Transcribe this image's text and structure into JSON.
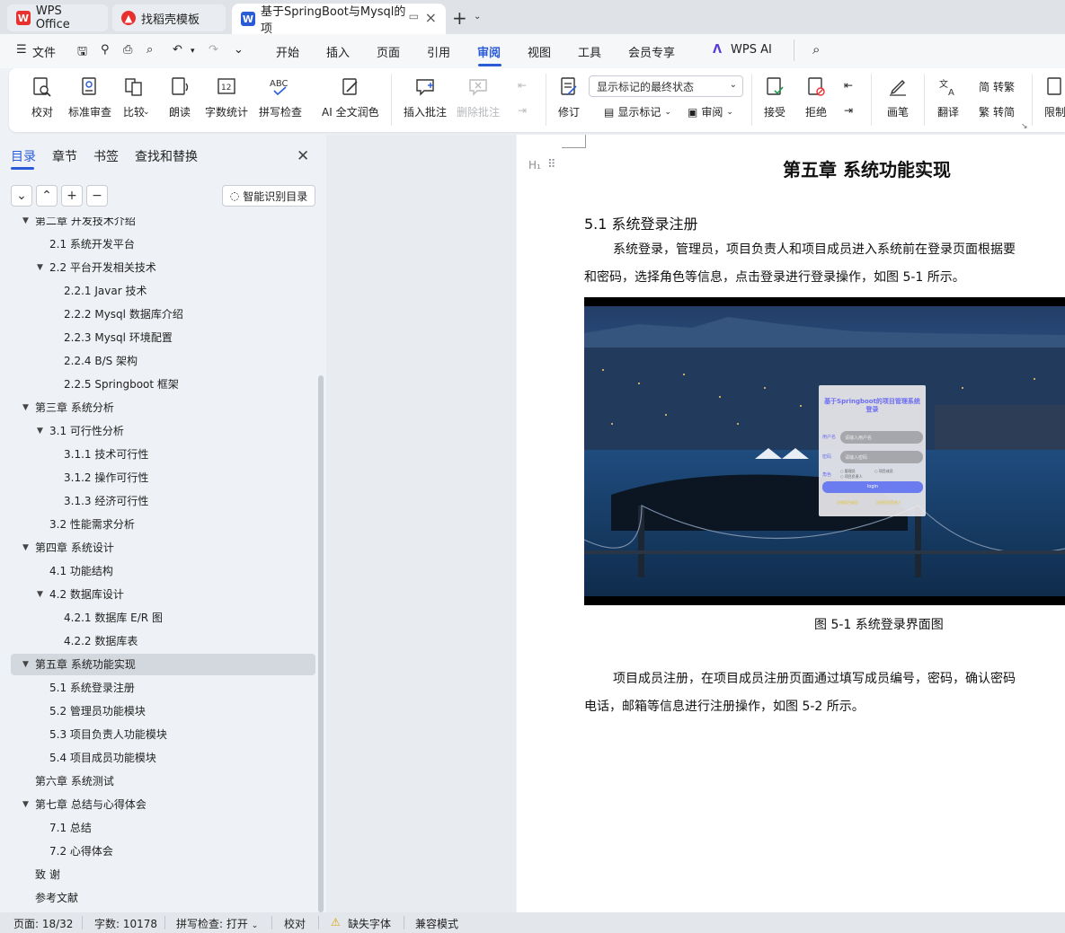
{
  "tabs": [
    {
      "label": "WPS Office"
    },
    {
      "label": "找稻壳模板"
    },
    {
      "label": "基于SpringBoot与Mysql的项"
    }
  ],
  "menu": {
    "file": "文件",
    "items": [
      "开始",
      "插入",
      "页面",
      "引用",
      "审阅",
      "视图",
      "工具",
      "会员专享",
      "WPS AI"
    ]
  },
  "ribbon": {
    "proofread": "校对",
    "standard_review": "标准审查",
    "compare": "比较",
    "read_aloud": "朗读",
    "word_count": "字数统计",
    "spell_check": "拼写检查",
    "ai_polish": "AI 全文润色",
    "insert_comment": "插入批注",
    "delete_comment": "删除批注",
    "track_changes": "修订",
    "markup_select": "显示标记的最终状态",
    "show_markup": "显示标记",
    "review": "审阅",
    "accept": "接受",
    "reject": "拒绝",
    "pen": "画笔",
    "translate": "翻译",
    "to_traditional": "转繁",
    "to_simplified": "转简",
    "restrict": "限制"
  },
  "nav": {
    "tabs": [
      "目录",
      "章节",
      "书签",
      "查找和替换"
    ],
    "smart_toc": "智能识别目录",
    "toc": [
      {
        "label": "第二章  开发技术介绍",
        "level": 1,
        "expand": true
      },
      {
        "label": "2.1  系统开发平台",
        "level": 2
      },
      {
        "label": "2.2  平台开发相关技术",
        "level": 2,
        "expand": true
      },
      {
        "label": "2.2.1    Javar 技术",
        "level": 3
      },
      {
        "label": "2.2.2    Mysql 数据库介绍",
        "level": 3
      },
      {
        "label": "2.2.3    Mysql 环境配置",
        "level": 3
      },
      {
        "label": "2.2.4    B/S 架构",
        "level": 3
      },
      {
        "label": "2.2.5    Springboot 框架",
        "level": 3
      },
      {
        "label": "第三章  系统分析",
        "level": 1,
        "expand": true
      },
      {
        "label": "3.1  可行性分析",
        "level": 2,
        "expand": true
      },
      {
        "label": "3.1.1 技术可行性",
        "level": 3
      },
      {
        "label": "3.1.2 操作可行性",
        "level": 3
      },
      {
        "label": "3.1.3 经济可行性",
        "level": 3
      },
      {
        "label": "3.2 性能需求分析",
        "level": 2
      },
      {
        "label": "第四章  系统设计",
        "level": 1,
        "expand": true
      },
      {
        "label": "4.1 功能结构",
        "level": 2
      },
      {
        "label": "4.2  数据库设计",
        "level": 2,
        "expand": true
      },
      {
        "label": "4.2.1   数据库 E/R 图",
        "level": 3
      },
      {
        "label": "4.2.2   数据库表",
        "level": 3
      },
      {
        "label": "第五章  系统功能实现",
        "level": 1,
        "expand": true,
        "selected": true
      },
      {
        "label": "5.1 系统登录注册",
        "level": 2
      },
      {
        "label": "5.2 管理员功能模块",
        "level": 2
      },
      {
        "label": "5.3 项目负责人功能模块",
        "level": 2
      },
      {
        "label": "5.4 项目成员功能模块",
        "level": 2
      },
      {
        "label": "第六章  系统测试",
        "level": 1
      },
      {
        "label": "第七章  总结与心得体会",
        "level": 1,
        "expand": true
      },
      {
        "label": "7.1 总结",
        "level": 2
      },
      {
        "label": "7.2 心得体会",
        "level": 2
      },
      {
        "label": "致    谢",
        "level": 1
      },
      {
        "label": "参考文献",
        "level": 1
      }
    ]
  },
  "doc": {
    "chapter_title": "第五章  系统功能实现",
    "section_title": "5.1 系统登录注册",
    "para1_line1": "系统登录，管理员，项目负责人和项目成员进入系统前在登录页面根据要",
    "para1_line2": "和密码，选择角色等信息，点击登录进行登录操作，如图 5-1 所示。",
    "figure_caption": "图 5-1 系统登录界面图",
    "login_box": {
      "title": "基于Springboot的项目管理系统登录",
      "user_label": "用户名",
      "user_placeholder": "请输入用户名",
      "pass_label": "密码",
      "pass_placeholder": "请输入密码",
      "role_label": "角色",
      "roles": [
        "管理员",
        "项目成员",
        "项目负责人"
      ],
      "login_button": "login",
      "register_links": [
        "注册项目成员",
        "注册项目负责人"
      ]
    },
    "para2_line1": "项目成员注册，在项目成员注册页面通过填写成员编号，密码，确认密码",
    "para2_line2": "电话，邮箱等信息进行注册操作，如图 5-2 所示。"
  },
  "status": {
    "page": "页面: 18/32",
    "words": "字数: 10178",
    "spell": "拼写检查: 打开",
    "proof": "校对",
    "missing_font": "缺失字体",
    "compat": "兼容模式"
  },
  "colors": {
    "accent": "#2a5bd7",
    "wps_red": "#e8312f"
  }
}
